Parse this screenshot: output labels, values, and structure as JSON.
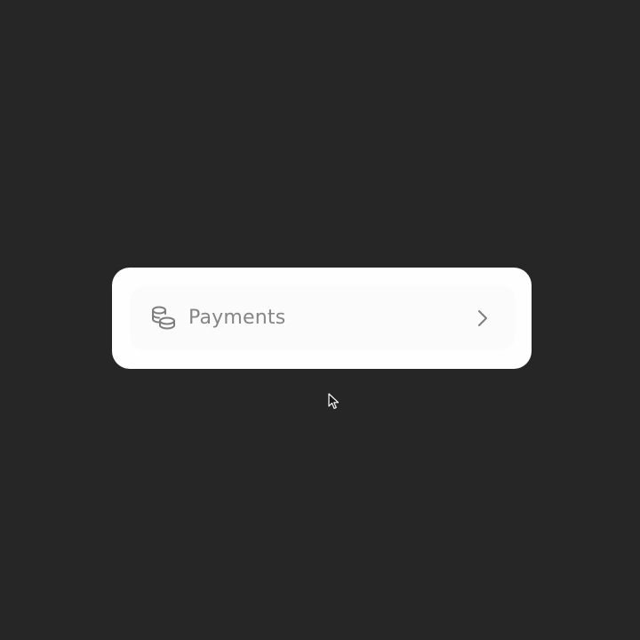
{
  "menu_item": {
    "label": "Payments",
    "icon": "coins-icon",
    "trailing_icon": "chevron-right-icon"
  },
  "colors": {
    "background": "#262626",
    "card": "#fefefe",
    "item": "#fbfbfb",
    "text": "#858585",
    "icon": "#7d7d7d"
  }
}
